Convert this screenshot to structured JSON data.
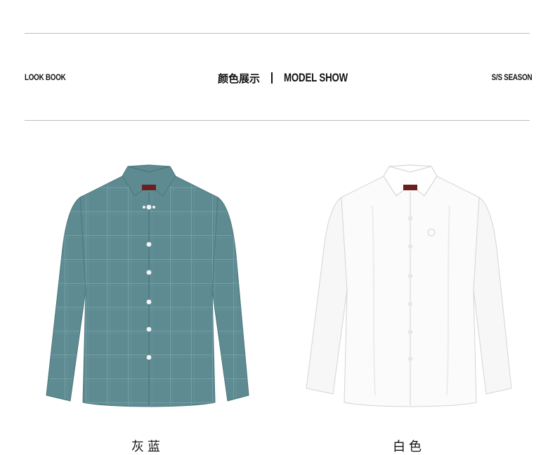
{
  "header": {
    "left_label": "LOOK BOOK",
    "center_cn": "颜色展示",
    "center_en": "MODEL SHOW",
    "right_label": "S/S SEASON"
  },
  "products": [
    {
      "caption": "灰蓝",
      "color": "#5d8b91",
      "image": "blue-grey-check-shirt"
    },
    {
      "caption": "白色",
      "color": "#f4f4f4",
      "image": "white-shirt"
    }
  ]
}
